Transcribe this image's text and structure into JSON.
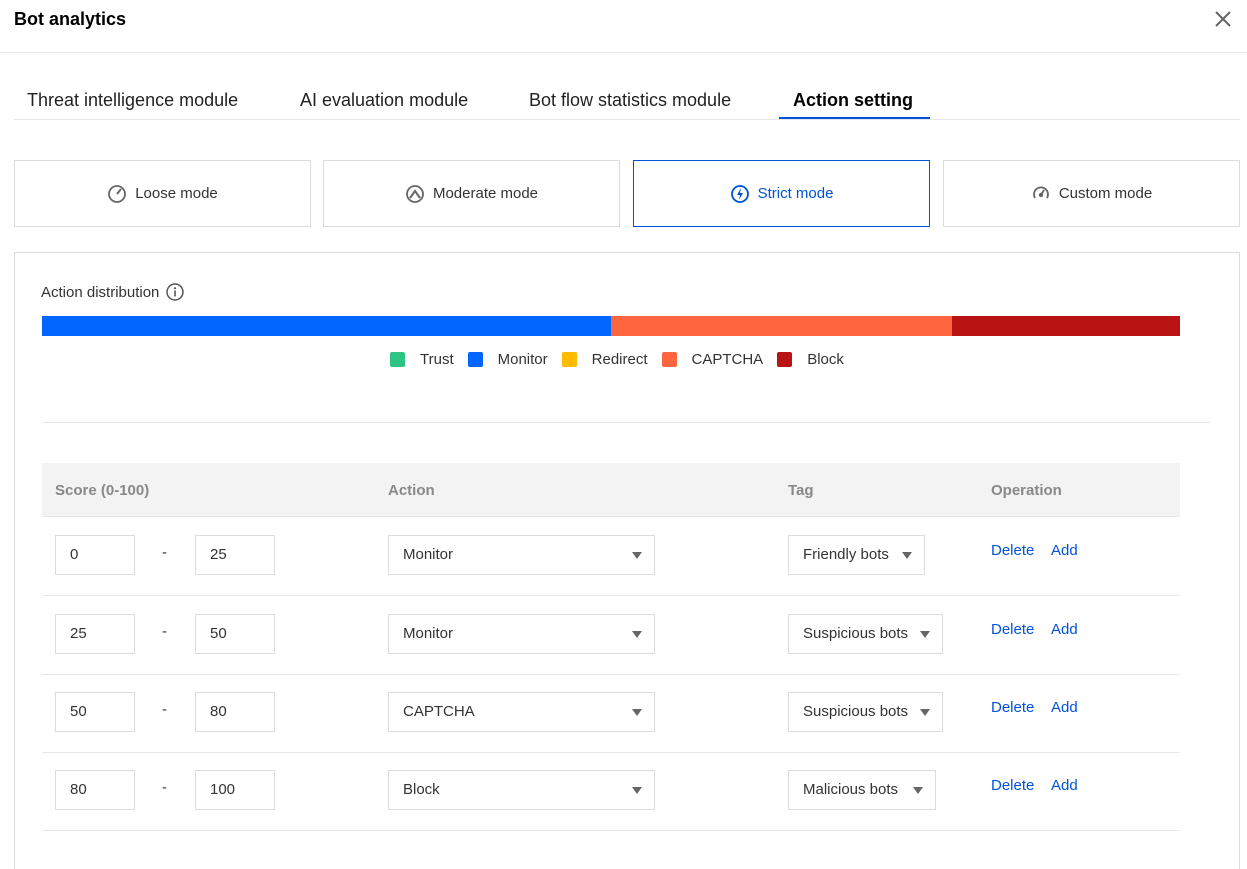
{
  "dialog": {
    "title": "Bot analytics"
  },
  "tabs": [
    {
      "label": "Threat intelligence module"
    },
    {
      "label": "AI evaluation module"
    },
    {
      "label": "Bot flow statistics module"
    },
    {
      "label": "Action setting",
      "active": true
    }
  ],
  "modes": [
    {
      "label": "Loose mode",
      "icon": "gauge-low-icon"
    },
    {
      "label": "Moderate mode",
      "icon": "gauge-mid-icon"
    },
    {
      "label": "Strict mode",
      "icon": "lightning-icon",
      "active": true
    },
    {
      "label": "Custom mode",
      "icon": "gauge-custom-icon"
    }
  ],
  "distribution": {
    "label": "Action distribution",
    "segments": [
      {
        "action": "Monitor",
        "fraction": 0.5,
        "color": "#0066ff"
      },
      {
        "action": "CAPTCHA",
        "fraction": 0.3,
        "color": "#ff6640"
      },
      {
        "action": "Block",
        "fraction": 0.2,
        "color": "#b81414"
      }
    ],
    "legend": [
      {
        "label": "Trust",
        "color": "#2ec483"
      },
      {
        "label": "Monitor",
        "color": "#0066ff"
      },
      {
        "label": "Redirect",
        "color": "#ffbb00"
      },
      {
        "label": "CAPTCHA",
        "color": "#ff6640"
      },
      {
        "label": "Block",
        "color": "#b81414"
      }
    ]
  },
  "table": {
    "headers": {
      "score": "Score (0-100)",
      "action": "Action",
      "tag": "Tag",
      "operation": "Operation"
    },
    "rows": [
      {
        "from": "0",
        "dash": "-",
        "to": "25",
        "action": "Monitor",
        "tag": "Friendly bots",
        "delete": "Delete",
        "add": "Add"
      },
      {
        "from": "25",
        "dash": "-",
        "to": "50",
        "action": "Monitor",
        "tag": "Suspicious bots",
        "delete": "Delete",
        "add": "Add"
      },
      {
        "from": "50",
        "dash": "-",
        "to": "80",
        "action": "CAPTCHA",
        "tag": "Suspicious bots",
        "delete": "Delete",
        "add": "Add"
      },
      {
        "from": "80",
        "dash": "-",
        "to": "100",
        "action": "Block",
        "tag": "Malicious bots",
        "delete": "Delete",
        "add": "Add"
      }
    ]
  },
  "colors": {
    "accent": "#0052d9"
  }
}
